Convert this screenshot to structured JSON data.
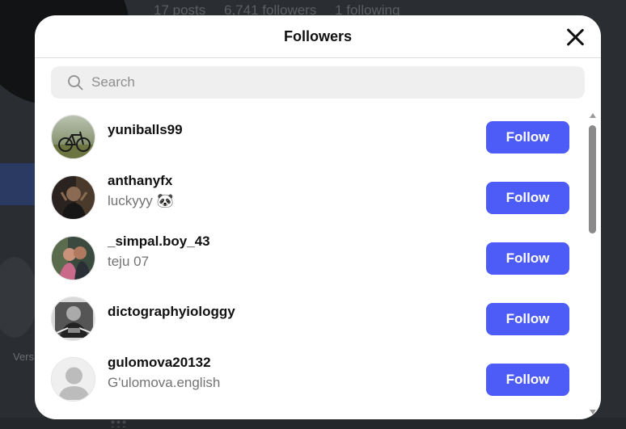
{
  "background": {
    "stats": [
      "17 posts",
      "6,741 followers",
      "1 following"
    ],
    "side_label": "Vers"
  },
  "modal": {
    "title": "Followers",
    "search_placeholder": "Search",
    "follow_label": "Follow",
    "accent_color": "#4d5cf7"
  },
  "followers": [
    {
      "username": "yuniballs99",
      "subtitle": "",
      "avatar": "bicycle-photo"
    },
    {
      "username": "anthanyfx",
      "subtitle": "luckyyy 🐼",
      "avatar": "person-photo"
    },
    {
      "username": "_simpal.boy_43",
      "subtitle": "teju 07",
      "avatar": "couple-photo"
    },
    {
      "username": "dictographyiologgy",
      "subtitle": "",
      "avatar": "monochrome-sketch"
    },
    {
      "username": "gulomova20132",
      "subtitle": "G'ulomova.english",
      "avatar": "default-avatar"
    }
  ]
}
